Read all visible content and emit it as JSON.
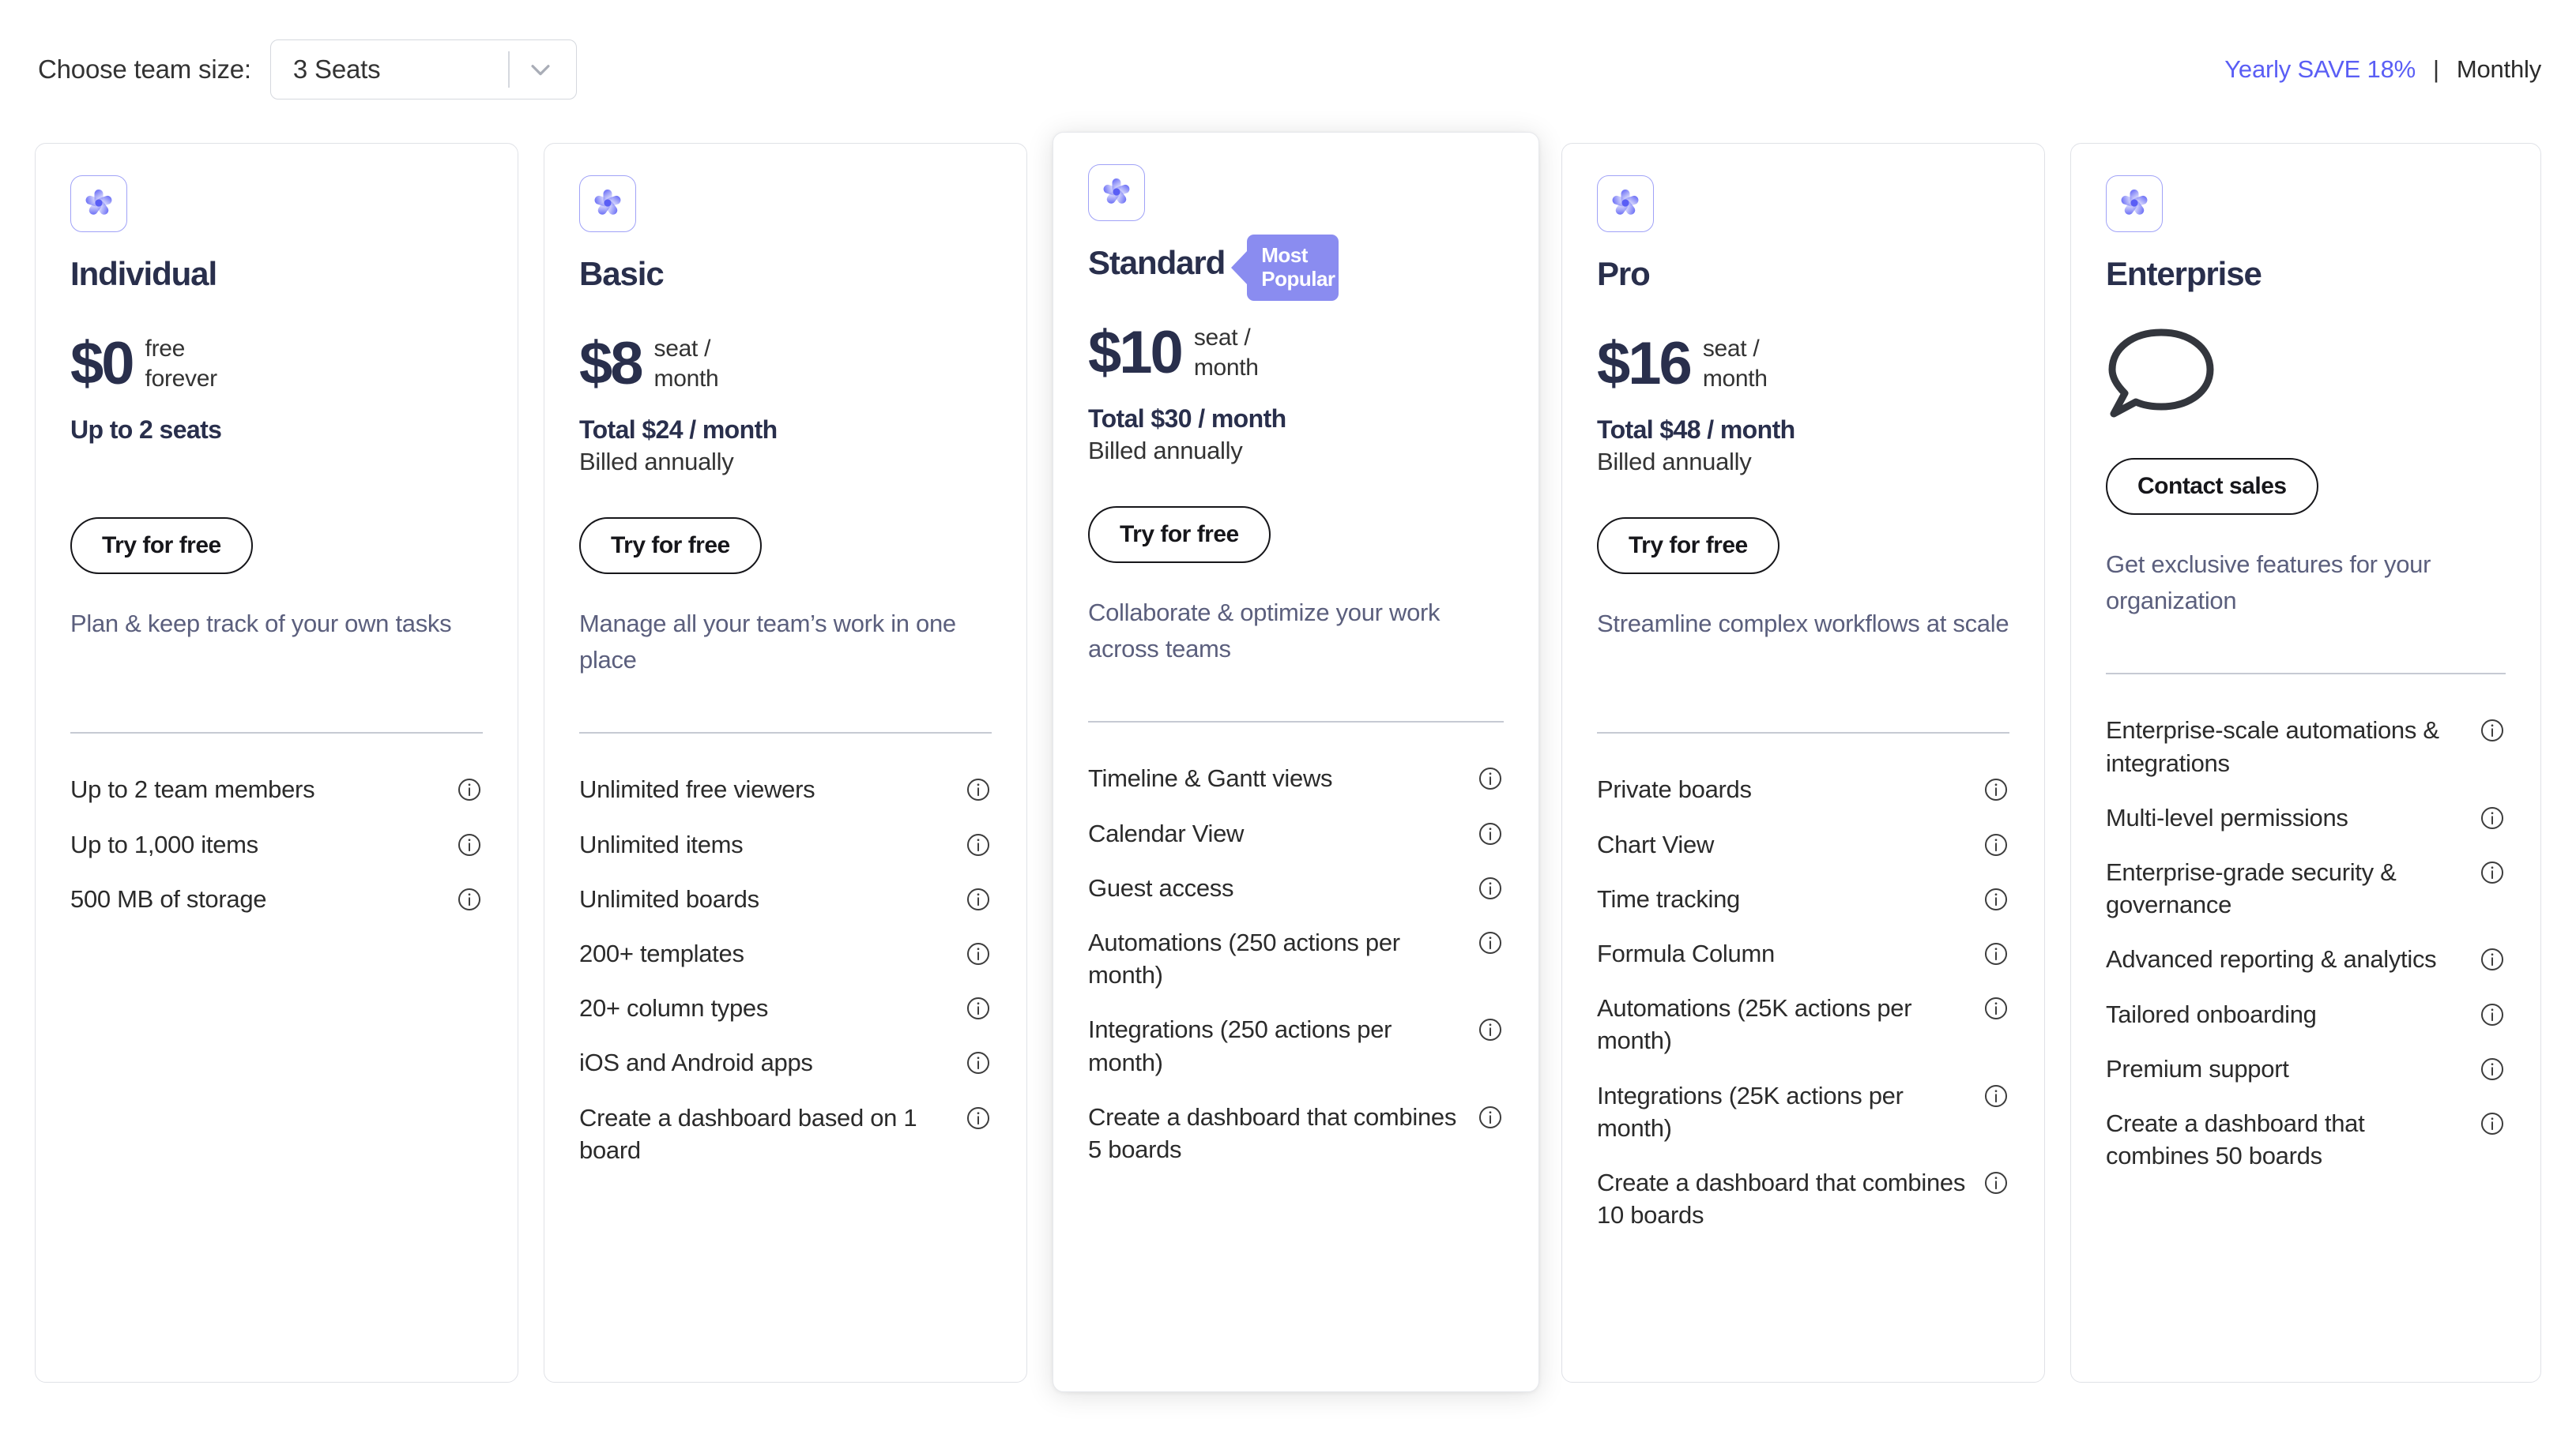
{
  "header": {
    "team_size_label": "Choose team size:",
    "team_size_value": "3 Seats",
    "team_size_placeholder": "Select seats",
    "yearly_label": "Yearly SAVE 18%",
    "separator": "|",
    "monthly_label": "Monthly",
    "accent_color": "#5a5ef5"
  },
  "colors": {
    "brand_purple": "#5a5ef5",
    "badge_purple": "#8a8cf0",
    "heading": "#292f4c",
    "muted_text": "#5b5f7d",
    "card_border": "#e0e2e7"
  },
  "plans": [
    {
      "name": "Individual",
      "logo_icon": "monday-logo-icon",
      "badge": null,
      "price": "$0",
      "price_unit": "free\nforever",
      "total": "Up to 2 seats",
      "billed": "",
      "icon": null,
      "cta": "Try for free",
      "tagline": "Plan & keep track of your own tasks",
      "features": [
        "Up to 2 team members",
        "Up to 1,000 items",
        "500 MB of storage"
      ]
    },
    {
      "name": "Basic",
      "logo_icon": "monday-logo-icon",
      "badge": null,
      "price": "$8",
      "price_unit": "seat /\nmonth",
      "total": "Total $24 / month",
      "billed": "Billed annually",
      "icon": null,
      "cta": "Try for free",
      "tagline": "Manage all your team’s work in one place",
      "features": [
        "Unlimited free viewers",
        "Unlimited items",
        "Unlimited boards",
        "200+ templates",
        "20+ column types",
        "iOS and Android apps",
        "Create a dashboard based on 1 board"
      ]
    },
    {
      "name": "Standard",
      "logo_icon": "monday-logo-icon",
      "badge": "Most Popular",
      "price": "$10",
      "price_unit": "seat /\nmonth",
      "total": "Total $30 / month",
      "billed": "Billed annually",
      "icon": null,
      "cta": "Try for free",
      "tagline": "Collaborate & optimize your work across teams",
      "features": [
        "Timeline & Gantt views",
        "Calendar View",
        "Guest access",
        "Automations (250 actions per month)",
        "Integrations (250 actions per month)",
        "Create a dashboard that combines 5 boards"
      ]
    },
    {
      "name": "Pro",
      "logo_icon": "monday-logo-icon",
      "badge": null,
      "price": "$16",
      "price_unit": "seat /\nmonth",
      "total": "Total $48 / month",
      "billed": "Billed annually",
      "icon": null,
      "cta": "Try for free",
      "tagline": "Streamline complex workflows at scale",
      "features": [
        "Private boards",
        "Chart View",
        "Time tracking",
        "Formula Column",
        "Automations (25K actions per month)",
        "Integrations (25K actions per month)",
        "Create a dashboard that combines 10 boards"
      ]
    },
    {
      "name": "Enterprise",
      "logo_icon": "monday-logo-icon",
      "badge": null,
      "price": "",
      "price_unit": "",
      "total": "",
      "billed": "",
      "icon": "speech-bubble-icon",
      "cta": "Contact sales",
      "tagline": "Get exclusive features for your organization",
      "features": [
        "Enterprise-scale automations & integrations",
        "Multi-level permissions",
        "Enterprise-grade security & governance",
        "Advanced reporting & analytics",
        "Tailored onboarding",
        "Premium support",
        "Create a dashboard that combines 50 boards"
      ]
    }
  ]
}
